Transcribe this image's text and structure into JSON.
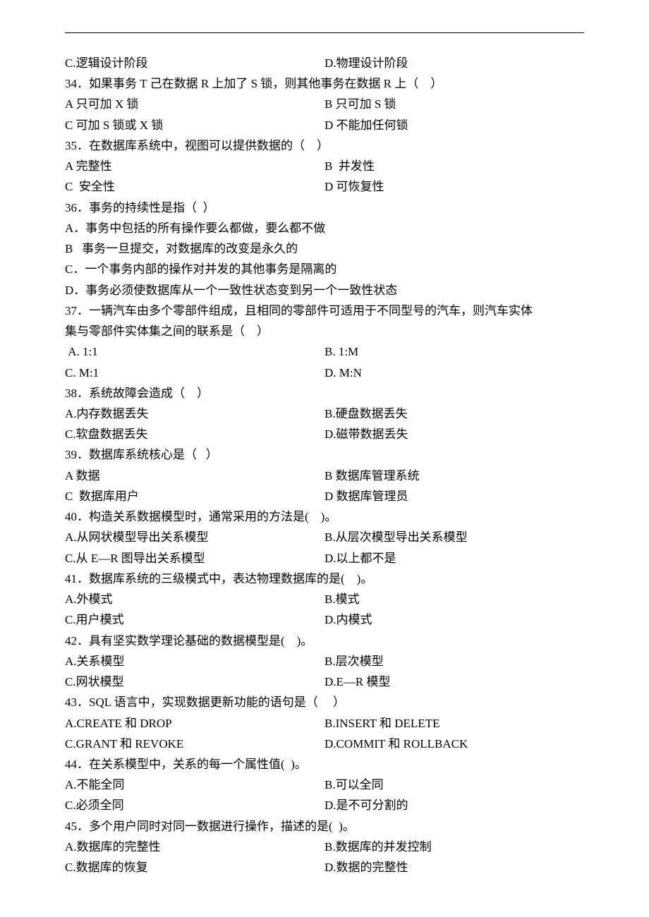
{
  "prev_opts": {
    "c": "C.逻辑设计阶段",
    "d": "D.物理设计阶段"
  },
  "q34": {
    "stem": "34．如果事务 T 己在数据 R 上加了 S 锁，则其他事务在数据 R 上（    ）",
    "a": "A 只可加 X 锁",
    "b": "B 只可加 S 锁",
    "c": "C 可加 S 锁或 X 锁",
    "d": "D 不能加任何锁"
  },
  "q35": {
    "stem": "35．在数据库系统中，视图可以提供数据的（    ）",
    "a": "A 完整性",
    "b": "B  并发性",
    "c": "C  安全性",
    "d": "D 可恢复性"
  },
  "q36": {
    "stem": "36．事务的持续性是指（  ）",
    "a": "A．事务中包括的所有操作要么都做，要么都不做",
    "b": "B   事务一旦提交，对数据库的改变是永久的",
    "c": "C．一个事务内部的操作对并发的其他事务是隔离的",
    "d": "D．事务必须使数据库从一个一致性状态变到另一个一致性状态"
  },
  "q37": {
    "stem1": "37．一辆汽车由多个零部件组成，且相同的零部件可适用于不同型号的汽车，则汽车实体",
    "stem2": "集与零部件实体集之间的联系是（    ）",
    "a": " A. 1:1",
    "b": "B. 1:M",
    "c": "C. M:1",
    "d": "D. M:N"
  },
  "q38": {
    "stem": "38．系统故障会造成（    ）",
    "a": "A.内存数据丢失",
    "b": "B.硬盘数据丢失",
    "c": "C.软盘数据丢失",
    "d": "D.磁带数据丢失"
  },
  "q39": {
    "stem": "39．数据库系统核心是（   ）",
    "a": "A 数据",
    "b": "B 数据库管理系统",
    "c": "C  数据库用户",
    "d": "D 数据库管理员"
  },
  "q40": {
    "stem": "40．构造关系数据模型时，通常采用的方法是(    )。",
    "a": "A.从网状模型导出关系模型",
    "b": "B.从层次模型导出关系模型",
    "c": "C.从 E—R 图导出关系模型",
    "d": "D.以上都不是"
  },
  "q41": {
    "stem": "41．数据库系统的三级模式中，表达物理数据库的是(    )。",
    "a": "A.外模式",
    "b": "B.模式",
    "c": "C.用户模式",
    "d": "D.内模式"
  },
  "q42": {
    "stem": "42．具有坚实数学理论基础的数据模型是(    )。",
    "a": "A.关系模型",
    "b": "B.层次模型",
    "c": "C.网状模型",
    "d": "D.E—R 模型"
  },
  "q43": {
    "stem": "43．SQL 语言中，实现数据更新功能的语句是（     ）",
    "a": "A.CREATE 和 DROP",
    "b": "B.INSERT 和 DELETE",
    "c": "C.GRANT 和 REVOKE",
    "d": "D.COMMIT 和 ROLLBACK"
  },
  "q44": {
    "stem": "44．在关系模型中，关系的每一个属性值(  )。",
    "a": "A.不能全同",
    "b": "B.可以全同",
    "c": "C.必须全同",
    "d": "D.是不可分割的"
  },
  "q45": {
    "stem": "45．多个用户同时对同一数据进行操作，描述的是(  )。",
    "a": "A.数据库的完整性",
    "b": "B.数据库的并发控制",
    "c": "C.数据库的恢复",
    "d": "D.数据的完整性"
  }
}
